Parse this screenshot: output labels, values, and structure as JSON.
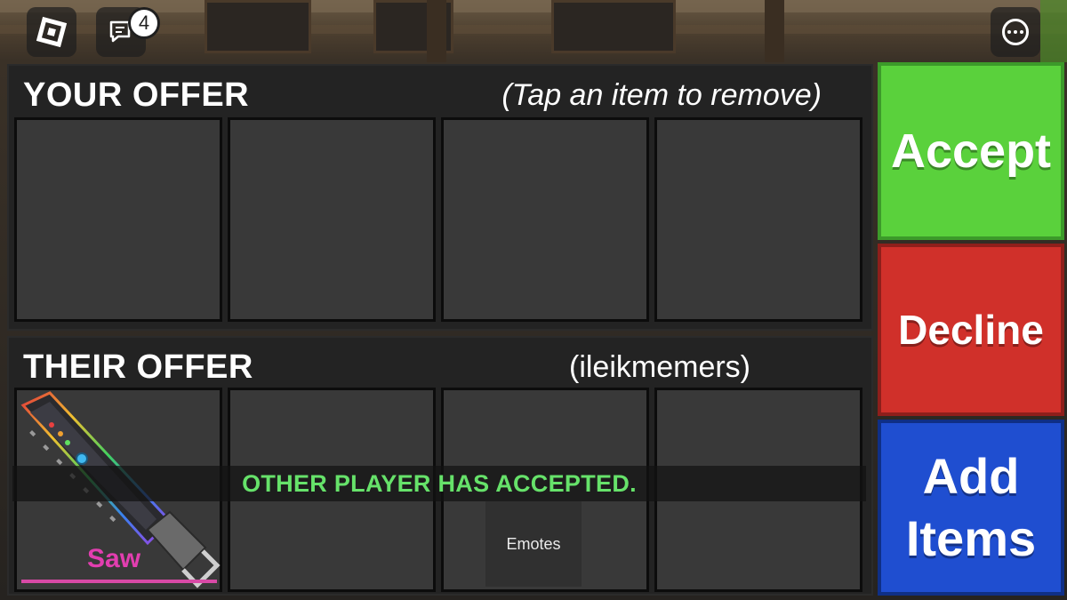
{
  "topbar": {
    "chat_badge_count": "4",
    "icons": [
      "roblox-logo-icon",
      "chat-icon",
      "more-options-icon"
    ]
  },
  "your_offer": {
    "title": "YOUR OFFER",
    "subtitle": "(Tap an item to remove)",
    "slots": [
      "",
      "",
      "",
      ""
    ]
  },
  "their_offer": {
    "title": "THEIR OFFER",
    "username": "(ileikmemers)",
    "slots": [
      {
        "item_name": "Saw",
        "item_icon": "saw-knife-icon",
        "name_color": "#e23eb0"
      },
      {
        "item_name": ""
      },
      {
        "item_name": ""
      },
      {
        "item_name": ""
      }
    ]
  },
  "status": {
    "text": "OTHER PLAYER HAS ACCEPTED.",
    "color": "#66e26a"
  },
  "emotes_label": "Emotes",
  "actions": {
    "accept_label": "Accept",
    "decline_label": "Decline",
    "add_items_line1": "Add",
    "add_items_line2": "Items",
    "accept_color": "#5ad13c",
    "decline_color": "#d0302a",
    "add_items_color": "#1f4ed0"
  }
}
